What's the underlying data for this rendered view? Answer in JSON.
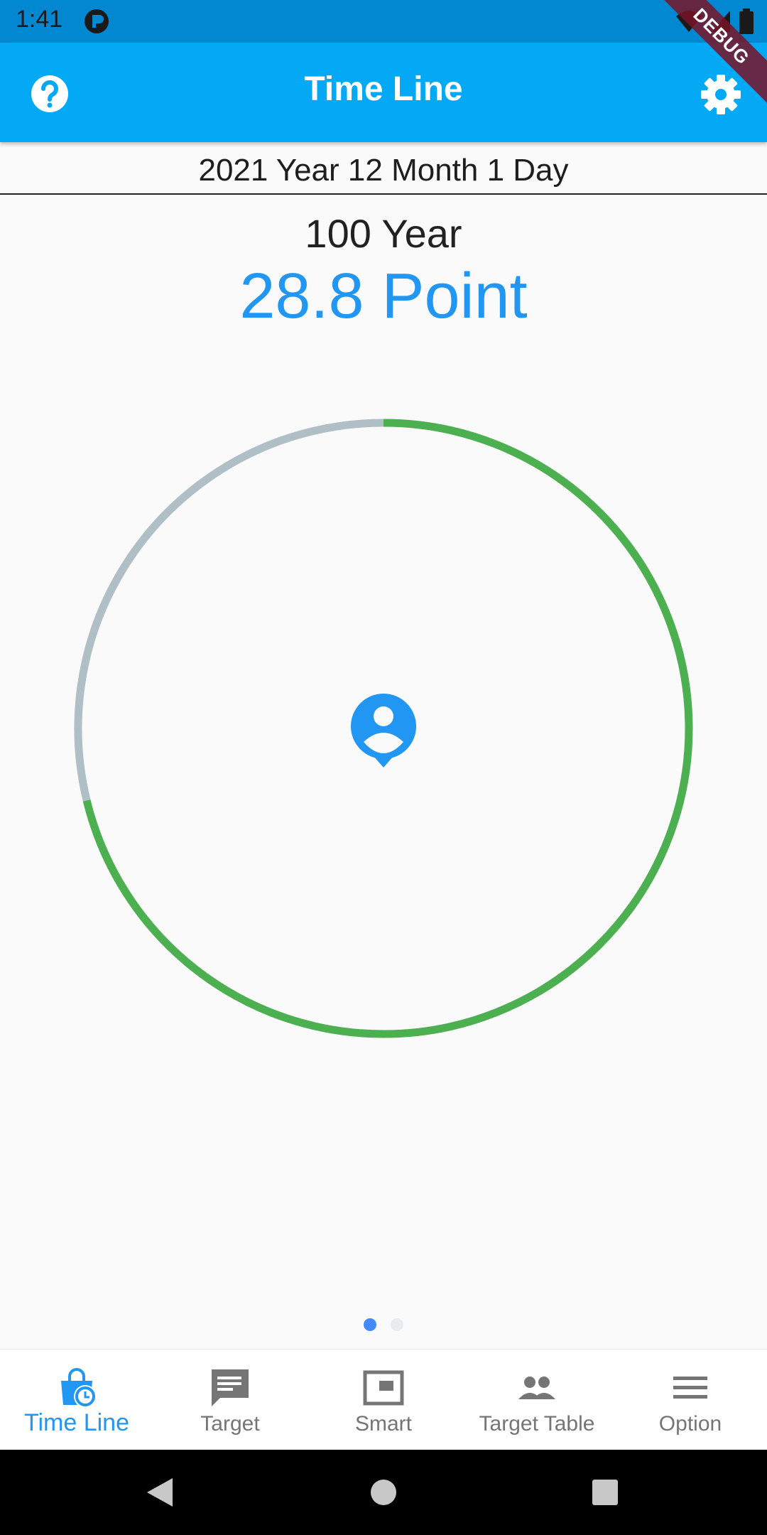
{
  "status_bar": {
    "time": "1:41"
  },
  "app_bar": {
    "title": "Time Line",
    "debug_label": "DEBUG"
  },
  "date_display": "2021 Year 12 Month 1 Day",
  "lifespan_label": "100 Year",
  "points_label": "28.8 Point",
  "progress": {
    "elapsed_fraction": 0.288,
    "elapsed_color": "#b0bec5",
    "remaining_color": "#4caf50"
  },
  "page_indicator": {
    "count": 2,
    "active_index": 0
  },
  "bottom_nav": {
    "active_index": 0,
    "items": [
      {
        "label": "Time Line",
        "icon": "shopping-bag-clock-icon"
      },
      {
        "label": "Target",
        "icon": "message-icon"
      },
      {
        "label": "Smart",
        "icon": "picture-in-picture-icon"
      },
      {
        "label": "Target Table",
        "icon": "people-icon"
      },
      {
        "label": "Option",
        "icon": "menu-icon"
      }
    ]
  },
  "colors": {
    "app_bar": "#03a9f4",
    "status_bar": "#0288d1",
    "accent": "#2196f3",
    "inactive": "#757575"
  }
}
